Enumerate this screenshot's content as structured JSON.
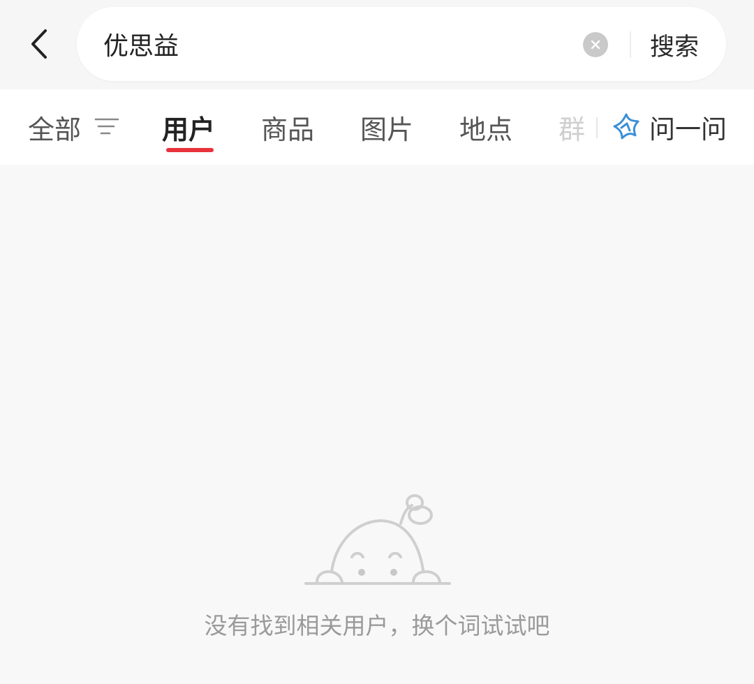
{
  "search": {
    "query": "优思益",
    "submit_label": "搜索"
  },
  "tabs": {
    "items": [
      {
        "label": "全部"
      },
      {
        "label": "用户"
      },
      {
        "label": "商品"
      },
      {
        "label": "图片"
      },
      {
        "label": "地点"
      },
      {
        "label": "群"
      }
    ],
    "active_index": 1,
    "ask_label": "问一问"
  },
  "empty_state": {
    "message": "没有找到相关用户，换个词试试吧"
  },
  "colors": {
    "accent": "#e8323c",
    "ask_icon": "#3b8fd6"
  }
}
